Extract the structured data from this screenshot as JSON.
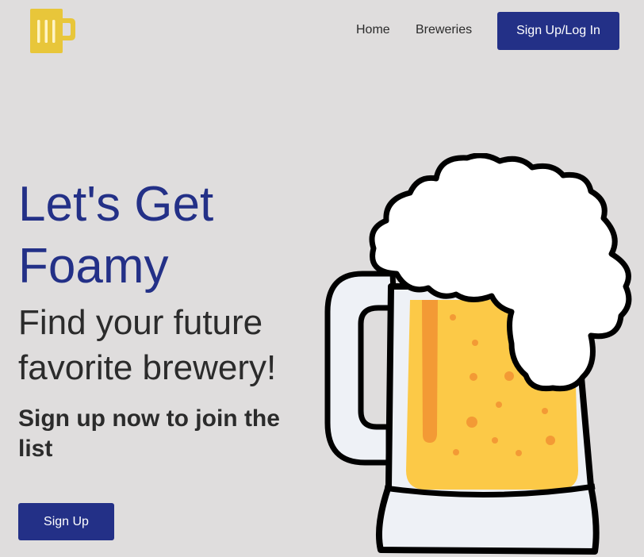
{
  "header": {
    "logo_icon": "beer-mug-icon",
    "logo_color": "#e8c63a",
    "nav": {
      "home_label": "Home",
      "breweries_label": "Breweries"
    },
    "login_button_label": "Sign Up/Log In"
  },
  "hero": {
    "title": "Let's Get Foamy",
    "subtitle": "Find your future favorite brewery!",
    "cta_text": "Sign up now to join the list",
    "signup_button_label": "Sign Up",
    "illustration_icon": "beer-mug-illustration"
  },
  "colors": {
    "background": "#dfdddd",
    "accent": "#233087",
    "text": "#2b2b2b",
    "beer": "#fcc947",
    "beer_stripe": "#f39a35"
  }
}
